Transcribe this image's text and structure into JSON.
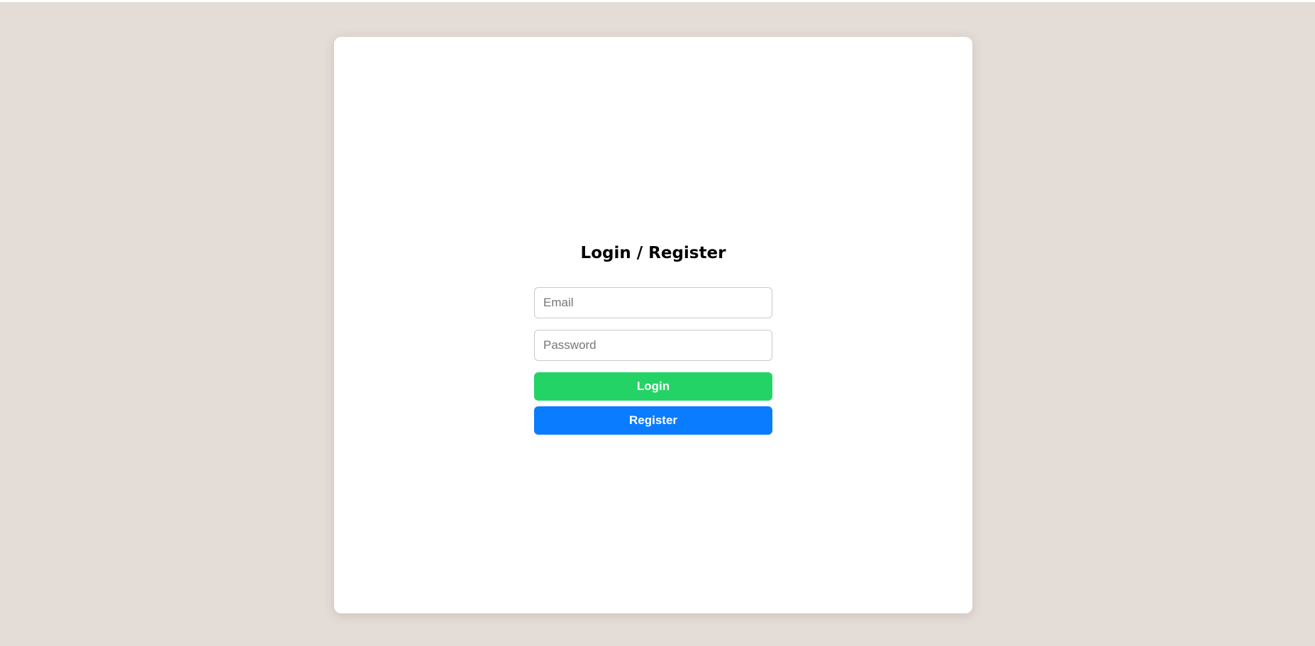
{
  "auth": {
    "title": "Login / Register",
    "email_placeholder": "Email",
    "password_placeholder": "Password",
    "login_label": "Login",
    "register_label": "Register"
  },
  "colors": {
    "page_background": "#e4dcd7",
    "card_background": "#ffffff",
    "login_button": "#24d366",
    "register_button": "#0a7cff"
  }
}
